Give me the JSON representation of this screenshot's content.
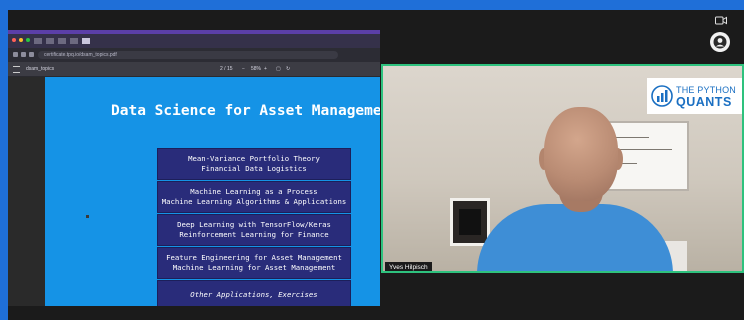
{
  "browser": {
    "url": "certificate.tpq.io/dsam_topics.pdf",
    "colors": {
      "close": "#ff5f57",
      "minimize": "#febc2e",
      "maximize": "#28c840"
    }
  },
  "pdf_toolbar": {
    "filename": "dsam_topics",
    "page_indicator": "2 / 15",
    "zoom": "58%"
  },
  "slide": {
    "title": "Data Science for Asset Management",
    "topics": [
      {
        "line1": "Mean-Variance Portfolio Theory",
        "line2": "Financial Data Logistics"
      },
      {
        "line1": "Machine Learning as a Process",
        "line2": "Machine Learning Algorithms & Applications"
      },
      {
        "line1": "Deep Learning with TensorFlow/Keras",
        "line2": "Reinforcement Learning for Finance"
      },
      {
        "line1": "Feature Engineering for Asset Management",
        "line2": "Machine Learning for Asset Management"
      },
      {
        "line1": "Other Applications, Exercises",
        "line2": ""
      }
    ]
  },
  "video": {
    "participant_name": "Yves Hilpisch",
    "logo": {
      "line1": "THE PYTHON",
      "line2": "QUANTS"
    },
    "border_color": "#2ec27e"
  },
  "controls": {
    "camera_icon": "camera-icon",
    "avatar_icon": "avatar-icon"
  }
}
